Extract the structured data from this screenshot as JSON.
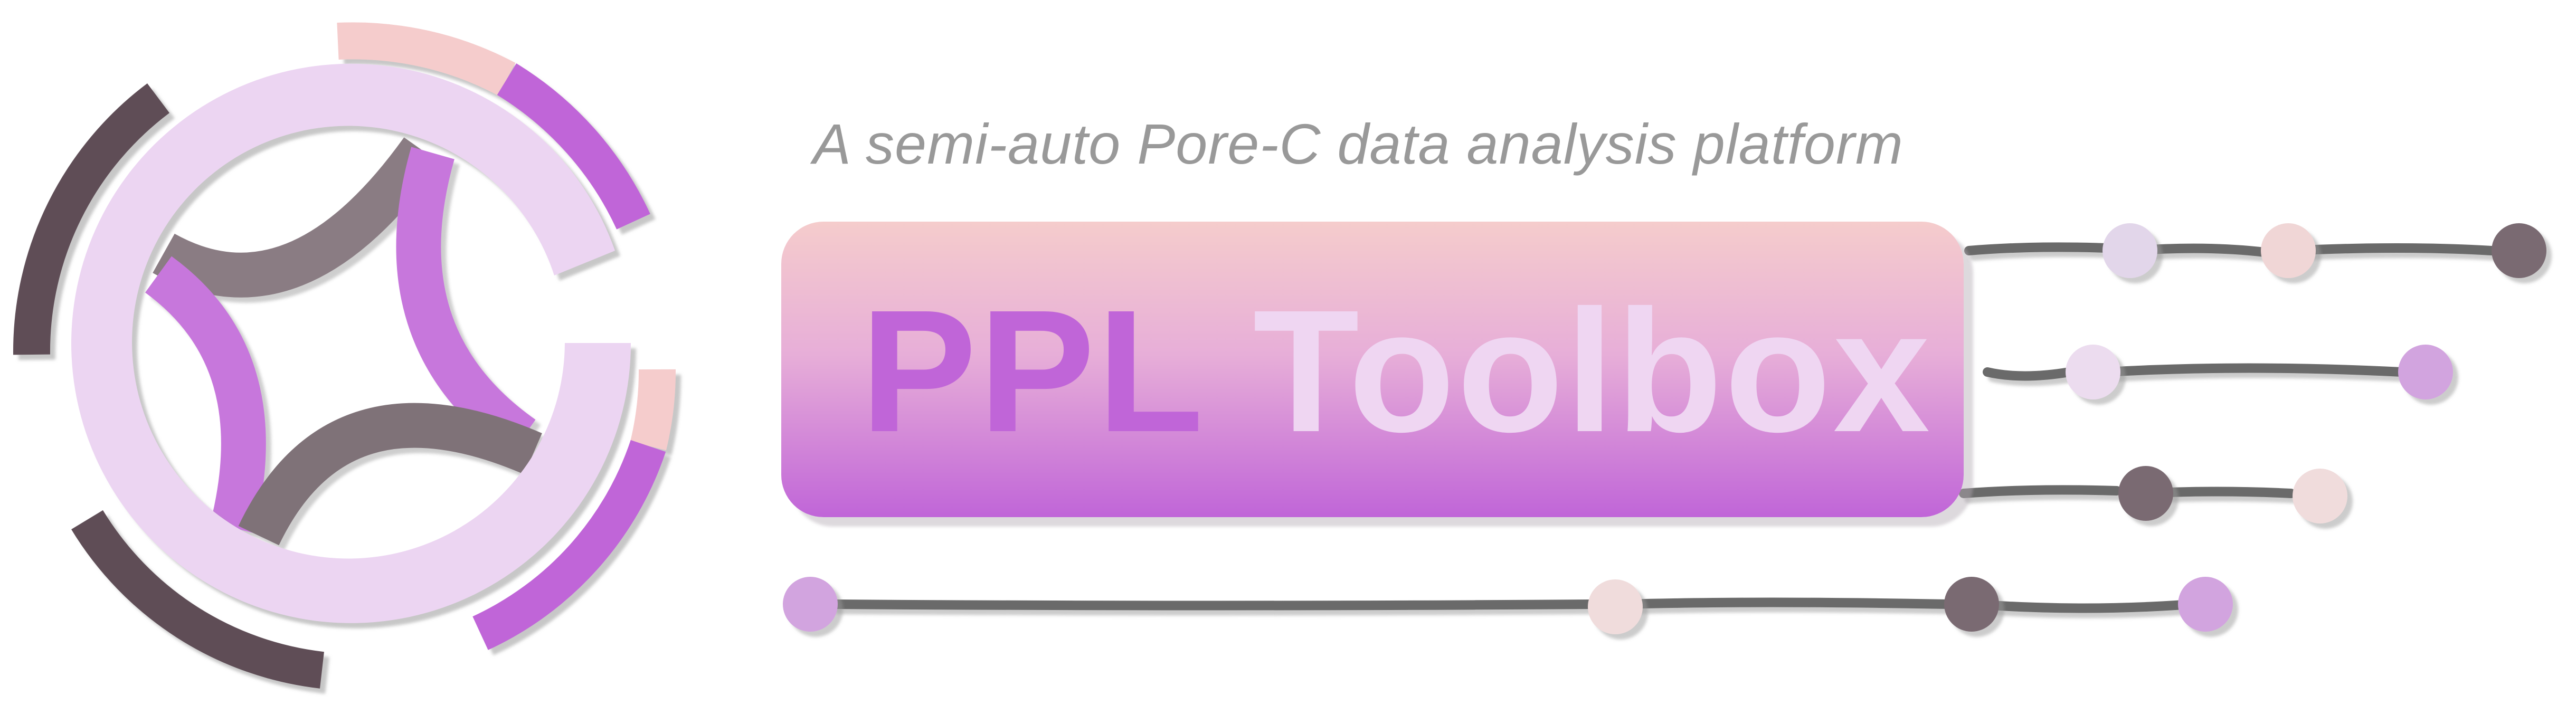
{
  "tagline": "A semi-auto Pore-C data analysis platform",
  "title": {
    "word1": "PPL",
    "word2": "Toolbox"
  },
  "colors": {
    "purple": "#c065d8",
    "lavender": "#ecd5f2",
    "pink": "#f5cccc",
    "dark": "#5e4e56",
    "gray_link": "#666666",
    "tagline_gray": "#999999"
  },
  "icons": [
    "ring-logo-icon",
    "molecule-links-icon"
  ]
}
